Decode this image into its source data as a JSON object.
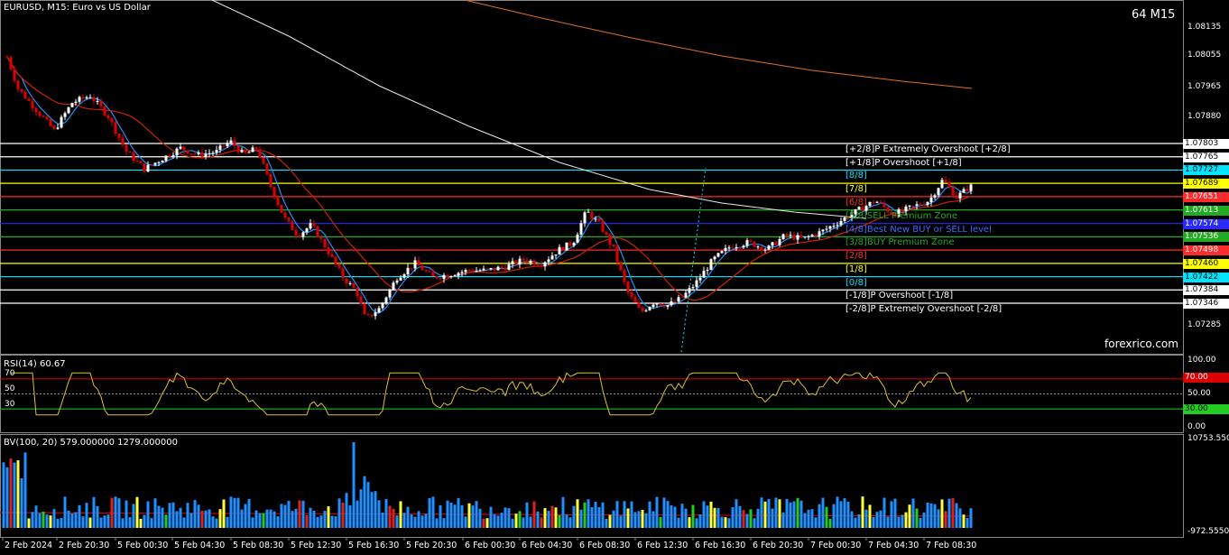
{
  "header": {
    "symbol": "EURUSD, M15:  Euro vs US Dollar",
    "timeframe_badge": "64 M15",
    "watermark": "forexrico.com"
  },
  "price_axis": [
    "1.08135",
    "1.08055",
    "1.07965",
    "1.07880",
    "1.07803",
    "1.07765",
    "1.07727",
    "1.07689",
    "1.07651",
    "1.07613",
    "1.07574",
    "1.07536",
    "1.07498",
    "1.07460",
    "1.07422",
    "1.07384",
    "1.07346",
    "1.07285"
  ],
  "murrey_levels": [
    {
      "label": "[+2/8]P Extremely Overshoot [+2/8]",
      "price": "1.07803",
      "color": "#ffffff"
    },
    {
      "label": "[+1/8]P Overshoot [+1/8]",
      "price": "1.07765",
      "color": "#ffffff"
    },
    {
      "label": "[8/8]",
      "price": "1.07727",
      "color": "#00e5ff"
    },
    {
      "label": "[7/8]",
      "price": "1.07689",
      "color": "#ffff00"
    },
    {
      "label": "[6/8]",
      "price": "1.07651",
      "color": "#ff2a2a"
    },
    {
      "label": "[5/8]SELL Premium Zone",
      "price": "1.07613",
      "color": "#22aa22"
    },
    {
      "label": "[4/8]Best New BUY or SELL level",
      "price": "1.07574",
      "color": "#2a2aff"
    },
    {
      "label": "[3/8]BUY Premium Zone",
      "price": "1.07536",
      "color": "#22aa22"
    },
    {
      "label": "[2/8]",
      "price": "1.07498",
      "color": "#ff2a2a"
    },
    {
      "label": "[1/8]",
      "price": "1.07460",
      "color": "#ffff00"
    },
    {
      "label": "[0/8]",
      "price": "1.07422",
      "color": "#00e5ff"
    },
    {
      "label": "[-1/8]P Overshoot [-1/8]",
      "price": "1.07384",
      "color": "#ffffff"
    },
    {
      "label": "[-2/8]P Extremely Overshoot [-2/8]",
      "price": "1.07346",
      "color": "#ffffff"
    }
  ],
  "rsi": {
    "title": "RSI(14) 60.67",
    "left_levels": [
      "70",
      "50",
      "30"
    ],
    "axis": [
      "100.00",
      "70.00",
      "50.00",
      "30.00",
      "0.00"
    ]
  },
  "volume": {
    "title": "BV(100, 20) 579.000000 1279.000000",
    "axis_top": "10753.55000",
    "axis_bottom": "-972.555000"
  },
  "time_axis": [
    "2 Feb 2024",
    "2 Feb 20:30",
    "5 Feb 00:30",
    "5 Feb 04:30",
    "5 Feb 08:30",
    "5 Feb 12:30",
    "5 Feb 16:30",
    "5 Feb 20:30",
    "6 Feb 00:30",
    "6 Feb 04:30",
    "6 Feb 08:30",
    "6 Feb 12:30",
    "6 Feb 16:30",
    "6 Feb 20:30",
    "7 Feb 00:30",
    "7 Feb 04:30",
    "7 Feb 08:30"
  ],
  "colors": {
    "bull": "#ffffff",
    "bear": "#dd0000",
    "ma_blue": "#1e90ff",
    "ma_red": "#cc2200",
    "ma_white": "#e8e8e8",
    "ma_orange": "#e07020",
    "rsi_line": "#d8c030"
  }
}
